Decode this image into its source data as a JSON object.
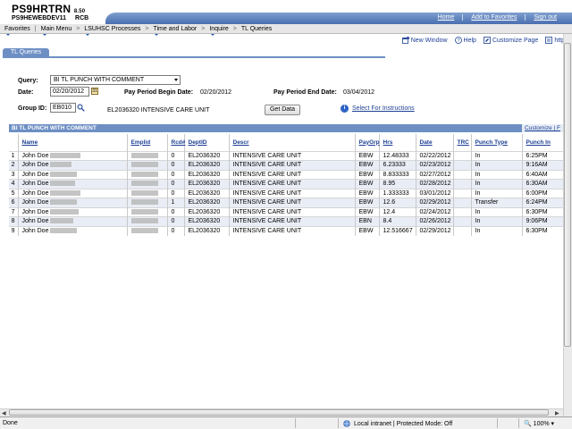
{
  "banner": {
    "app_title": "PS9HRTRN",
    "app_version": "8.50",
    "env_name": "PS9HEWEBDEV11",
    "env_code": "RCB",
    "links": [
      "Home",
      "Add to Favorites",
      "Sign out"
    ]
  },
  "nav": {
    "items": [
      "Favorites",
      "Main Menu",
      "LSUHSC Processes",
      "Time and Labor",
      "Inquire",
      "TL Queries"
    ]
  },
  "toolbar": {
    "new_window": "New Window",
    "help": "Help",
    "customize_page": "Customize Page",
    "http": "http"
  },
  "tab": {
    "label": "TL Queries"
  },
  "form": {
    "query_label": "Query:",
    "query_value": "BI TL PUNCH WITH COMMENT",
    "date_label": "Date:",
    "date_value": "02/20/2012",
    "begin_label": "Pay Period Begin Date:",
    "begin_value": "02/20/2012",
    "end_label": "Pay Period End Date:",
    "end_value": "03/04/2012",
    "group_label": "Group ID:",
    "group_value": "EB010",
    "group_desc": "EL2036320 INTENSIVE CARE UNIT",
    "get_data": "Get Data",
    "instructions": "Select For Instructions"
  },
  "grid": {
    "title": "BI TL PUNCH WITH COMMENT",
    "customize": "Customize | F",
    "columns": [
      "Name",
      "Emplid",
      "Rcd#",
      "DeptID",
      "Descr",
      "PayGrp",
      "Hrs",
      "Date",
      "TRC",
      "Punch Type",
      "Punch In"
    ],
    "rows": [
      [
        "1",
        "John Doe",
        "",
        "0",
        "EL2036320",
        "INTENSIVE CARE UNIT",
        "EBW",
        "12.48333",
        "02/22/2012",
        "",
        "In",
        "6:25PM"
      ],
      [
        "2",
        "John Doe",
        "",
        "0",
        "EL2036320",
        "INTENSIVE CARE UNIT",
        "EBW",
        "6.23333",
        "02/23/2012",
        "",
        "In",
        "9:16AM"
      ],
      [
        "3",
        "John Doe",
        "",
        "0",
        "EL2036320",
        "INTENSIVE CARE UNIT",
        "EBW",
        "8.833333",
        "02/27/2012",
        "",
        "In",
        "6:40AM"
      ],
      [
        "4",
        "John Doe",
        "",
        "0",
        "EL2036320",
        "INTENSIVE CARE UNIT",
        "EBW",
        "8.95",
        "02/28/2012",
        "",
        "In",
        "6:30AM"
      ],
      [
        "5",
        "John Doe",
        "",
        "0",
        "EL2036320",
        "INTENSIVE CARE UNIT",
        "EBW",
        "1.333333",
        "03/01/2012",
        "",
        "In",
        "6:00PM"
      ],
      [
        "6",
        "John Doe",
        "",
        "1",
        "EL2036320",
        "INTENSIVE CARE UNIT",
        "EBW",
        "12.6",
        "02/29/2012",
        "",
        "Transfer",
        "6:24PM"
      ],
      [
        "7",
        "John Doe",
        "",
        "0",
        "EL2036320",
        "INTENSIVE CARE UNIT",
        "EBW",
        "12.4",
        "02/24/2012",
        "",
        "In",
        "6:30PM"
      ],
      [
        "8",
        "John Doe",
        "",
        "0",
        "EL2036320",
        "INTENSIVE CARE UNIT",
        "EBN",
        "8.4",
        "02/26/2012",
        "",
        "In",
        "9:06PM"
      ],
      [
        "9",
        "John Doe",
        "",
        "0",
        "EL2036320",
        "INTENSIVE CARE UNIT",
        "EBW",
        "12.516667",
        "02/29/2012",
        "",
        "In",
        "6:30PM"
      ]
    ]
  },
  "status": {
    "left": "Done",
    "zone": "Local intranet | Protected Mode: Off",
    "zoom": "100%"
  },
  "colors": {
    "banner_blue": "#4a6fb0",
    "tab_blue": "#6d8fc4",
    "link_blue": "#1c3f94",
    "row_alt": "#e9edf6"
  }
}
